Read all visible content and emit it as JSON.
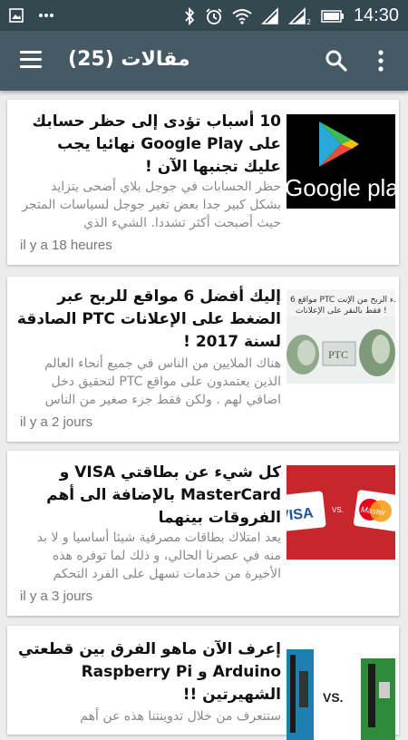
{
  "status_bar": {
    "time": "14:30",
    "icons": [
      "image-icon",
      "dots-icon",
      "bluetooth-icon",
      "alarm-icon",
      "wifi-icon",
      "signal-icon",
      "signal-2-icon",
      "battery-icon"
    ]
  },
  "app_bar": {
    "title": "مقالات (25)",
    "icons": [
      "hamburger-menu-icon",
      "search-icon",
      "more-vert-icon"
    ]
  },
  "articles": [
    {
      "title": "10 أسباب تؤدى إلى حظر حسابك على Google Play نهائيا يجب عليك تجنبها الآن !",
      "excerpt": "حظر الحسابات في جوجل بلاي أضحى يتزايد بشكل كبير جدا بعض تغير جوجل لسياسات المتجر حيث أصبحت أكثر تشددا. الشيء الذي",
      "time": "il y a 18 heures",
      "thumb_text": "Google pla"
    },
    {
      "title": "إليك أفضل 6 مواقع للربح عبر الضغط على الإعلانات PTC الصادقة لسنة 2017 !",
      "excerpt": "هناك الملايين من الناس في جميع أنحاء العالم الذين يعتمدون على مواقع PTC لتحقيق دخل اضافي لهم . ولكن فقط جزء صغير من الناس",
      "time": "il y a 2 jours",
      "thumb_text": "PTC"
    },
    {
      "title": "كل شيء عن بطاقتي VISA و MasterCard بالإضافة الى أهم الفروقات بينهما",
      "excerpt": "يعد امتلاك بطاقات مصرفية شيئا أساسيا و لا بد منه في عصرنا الحالي، و ذلك لما توفره هذه الأخيرة من خدمات تسهل على الفرد التحكم",
      "time": "il y a 3 jours",
      "thumb_text": "VS."
    },
    {
      "title": "إعرف الآن ماهو الفرق بين قطعتي Arduino و Raspberry Pi الشهيرتين !!",
      "excerpt": "ستتعرف من خلال تدوينتنا هذه عن أهم",
      "time": "",
      "thumb_text": "VS."
    }
  ]
}
